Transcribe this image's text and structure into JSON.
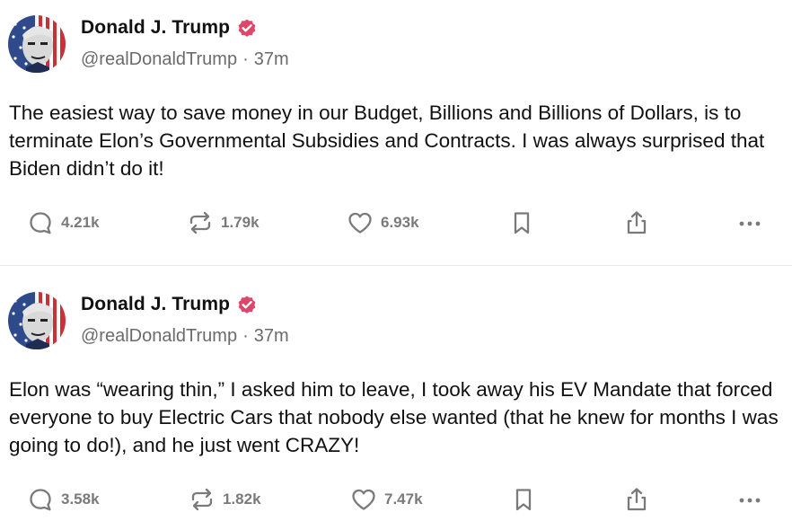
{
  "posts": [
    {
      "author_name": "Donald J. Trump",
      "handle": "@realDonaldTrump",
      "separator": "·",
      "time": "37m",
      "text": "The easiest way to save money in our Budget, Billions and Billions of Dollars, is to terminate Elon’s Governmental Subsidies and Contracts. I was always surprised that Biden didn’t do it!",
      "replies": "4.21k",
      "reposts": "1.79k",
      "likes": "6.93k"
    },
    {
      "author_name": "Donald J. Trump",
      "handle": "@realDonaldTrump",
      "separator": "·",
      "time": "37m",
      "text": "Elon was “wearing thin,” I asked him to leave, I took away his EV Mandate that forced everyone to buy Electric Cars that nobody else wanted (that he knew for months I was going to do!), and he just went CRAZY!",
      "replies": "3.58k",
      "reposts": "1.82k",
      "likes": "7.47k"
    }
  ],
  "icons": {
    "reply": "reply-icon",
    "repost": "repost-icon",
    "like": "heart-icon",
    "bookmark": "bookmark-icon",
    "share": "share-icon",
    "more": "more-icon",
    "verified": "verified-badge-icon"
  },
  "colors": {
    "verified_badge": "#e0456a",
    "icon": "#7a7a7a",
    "count": "#7a7a7a",
    "handle": "#6b6b6b"
  }
}
